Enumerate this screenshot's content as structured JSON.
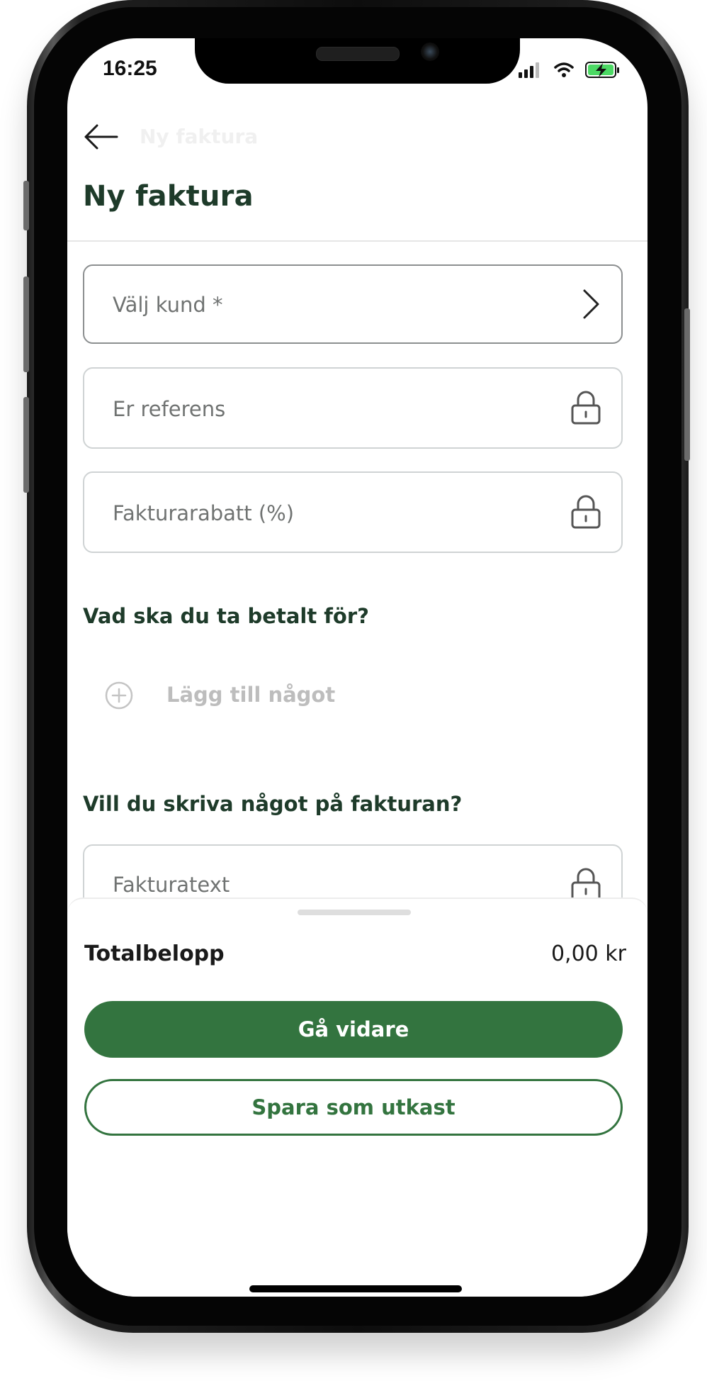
{
  "status_bar": {
    "time": "16:25"
  },
  "nav": {
    "ghost_title": "Ny faktura",
    "back_icon": "arrow-left-icon"
  },
  "page": {
    "title": "Ny faktura"
  },
  "form": {
    "customer": {
      "placeholder": "Välj kund *",
      "icon": "chevron-right-icon"
    },
    "reference": {
      "placeholder": "Er referens",
      "icon": "lock-icon"
    },
    "discount": {
      "placeholder": "Fakturarabatt (%)",
      "icon": "lock-icon"
    },
    "items_section_title": "Vad ska du ta betalt för?",
    "add_item_label": "Lägg till något",
    "text_section_title": "Vill du skriva något på fakturan?",
    "invoice_text": {
      "placeholder": "Fakturatext",
      "icon": "lock-icon"
    }
  },
  "summary": {
    "total_label": "Totalbelopp",
    "total_value": "0,00 kr",
    "primary_button": "Gå vidare",
    "secondary_button": "Spara som utkast"
  },
  "colors": {
    "brand_green": "#33743f",
    "title_dark_green": "#1e3b2a",
    "placeholder_gray": "#707372",
    "disabled_gray": "#bdbdbd"
  }
}
